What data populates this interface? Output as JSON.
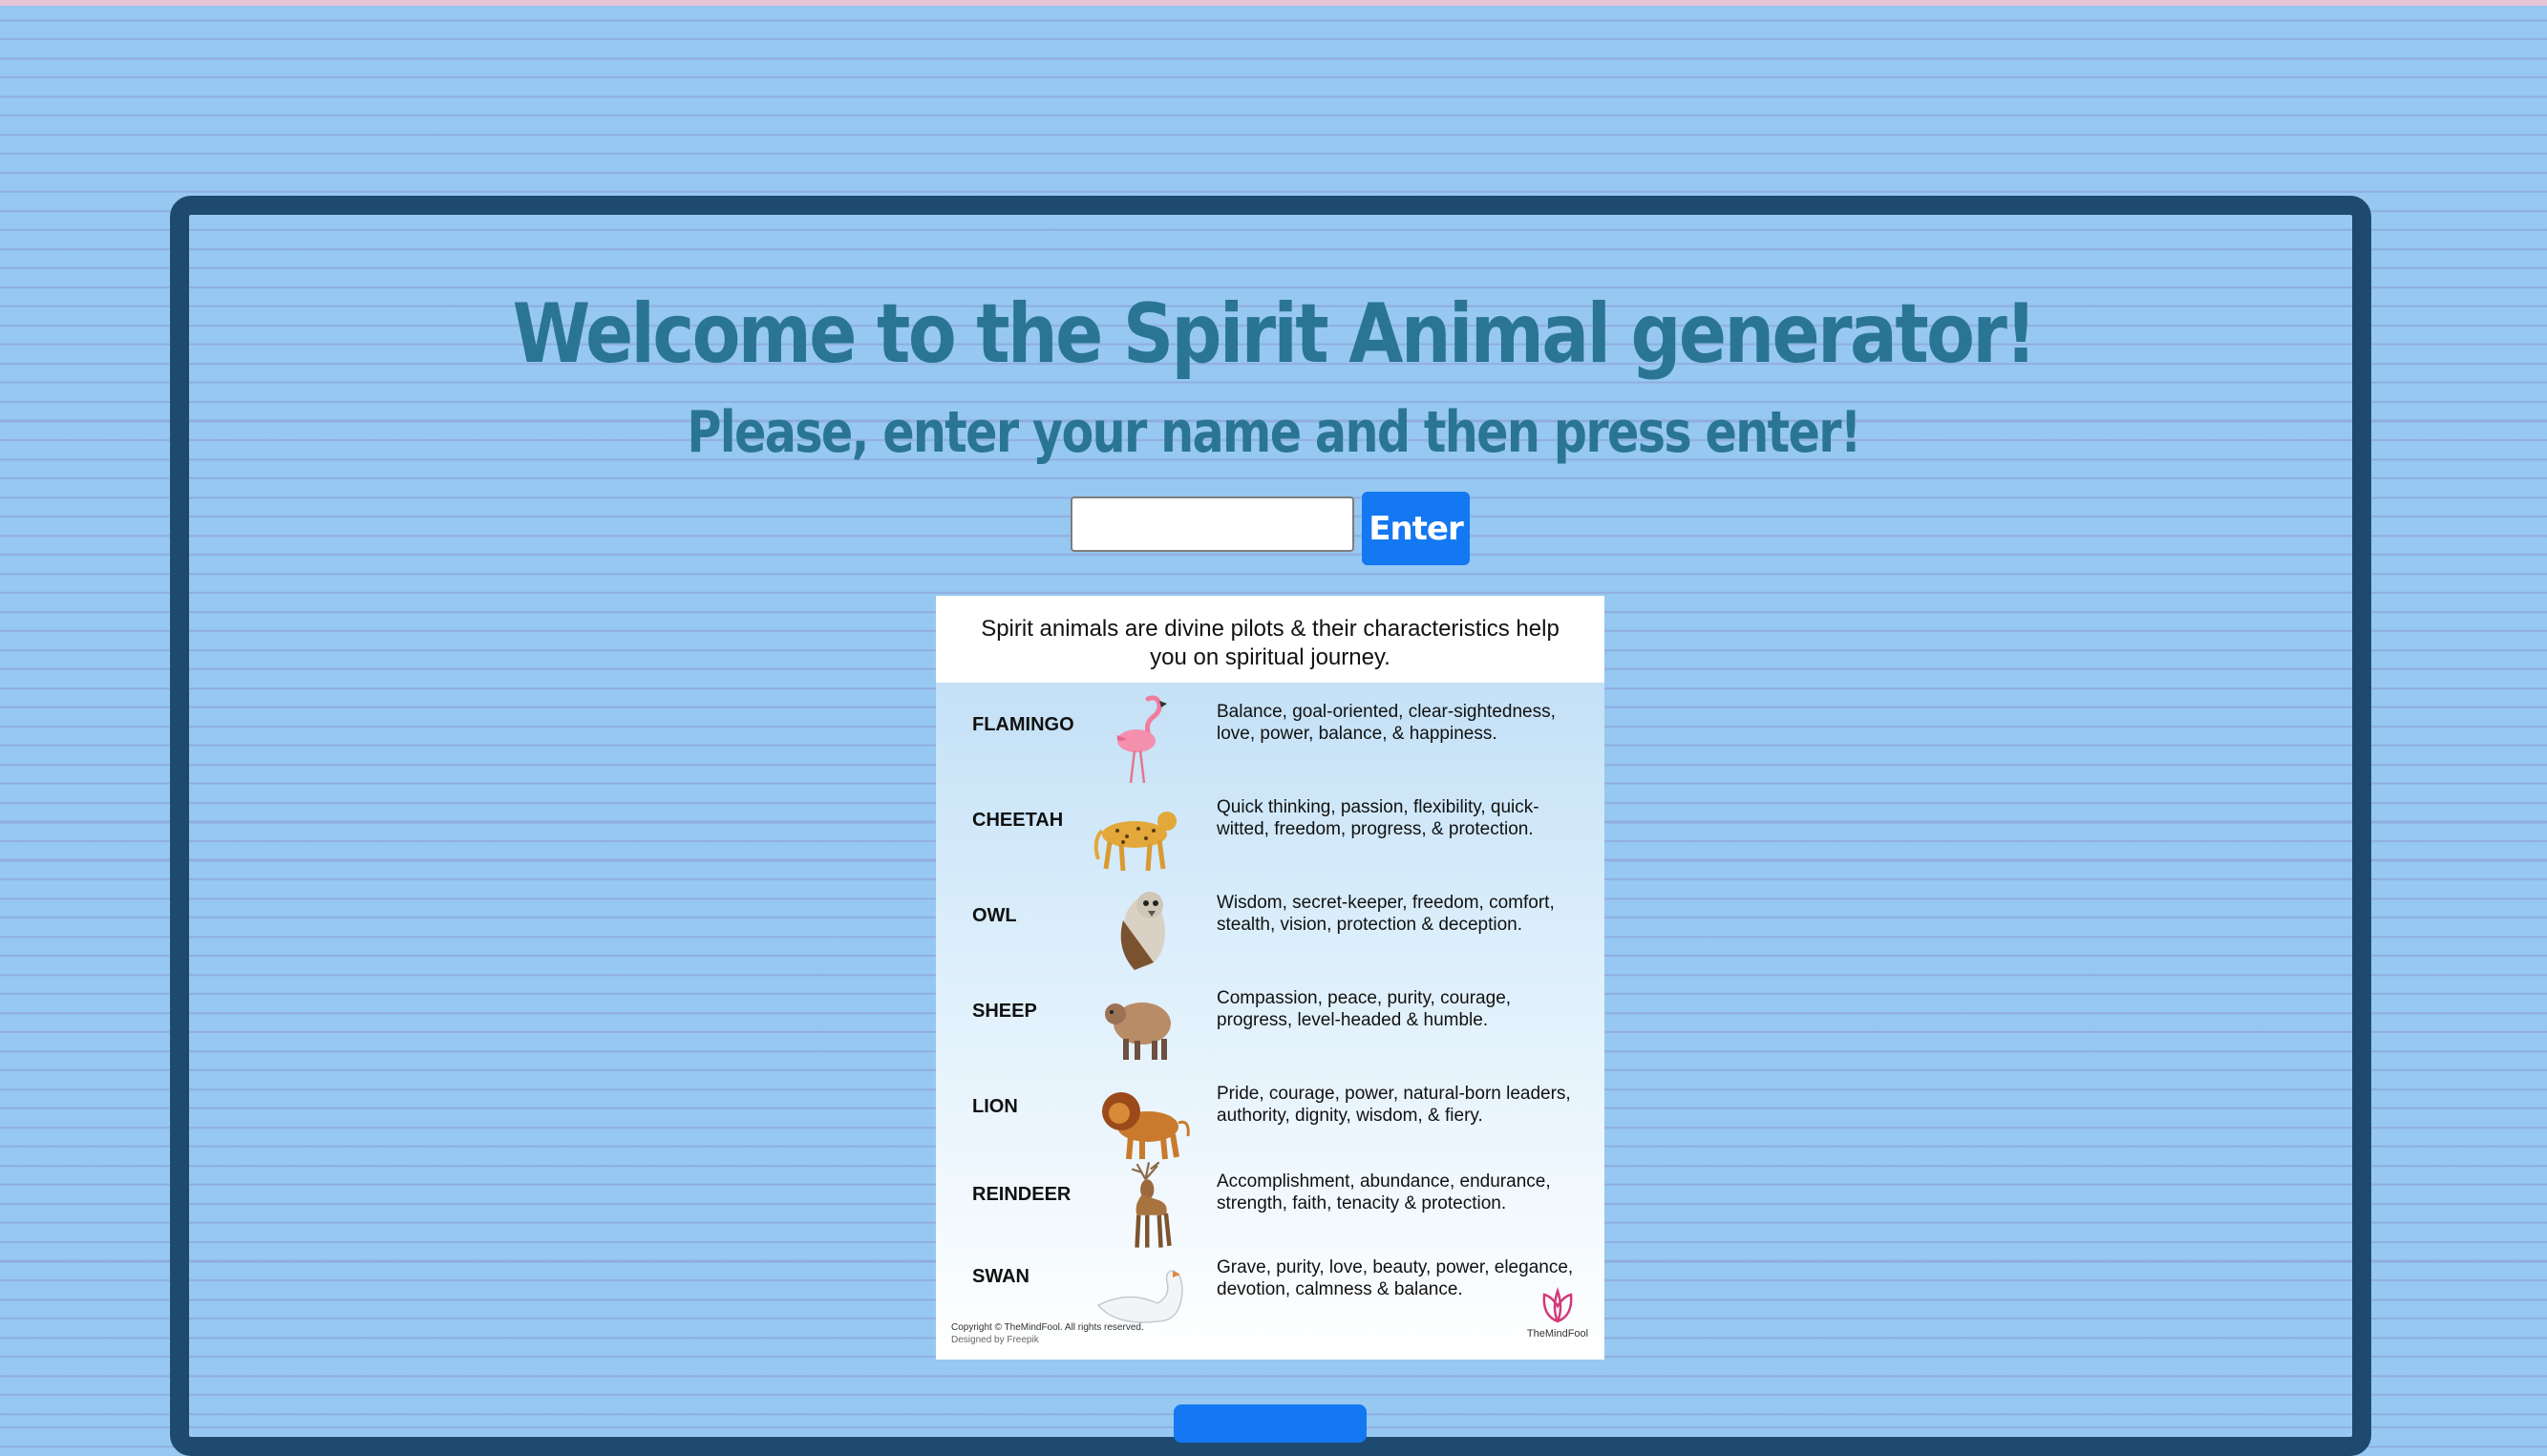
{
  "page": {
    "title": "Welcome to the Spirit Animal generator!",
    "subtitle": "Please, enter your name and then press enter!"
  },
  "form": {
    "name_value": "",
    "enter_label": "Enter"
  },
  "chart": {
    "intro_line1": "Spirit animals are divine pilots & their characteristics help",
    "intro_line2": "you on spiritual journey.",
    "animals": [
      {
        "name": "FLAMINGO",
        "icon": "flamingo-icon",
        "description": "Balance, goal-oriented, clear-sightedness, love, power, balance, & happiness."
      },
      {
        "name": "CHEETAH",
        "icon": "cheetah-icon",
        "description": "Quick thinking, passion, flexibility, quick-witted, freedom, progress, & protection."
      },
      {
        "name": "OWL",
        "icon": "owl-icon",
        "description": "Wisdom, secret-keeper, freedom, comfort, stealth, vision, protection & deception."
      },
      {
        "name": "SHEEP",
        "icon": "sheep-icon",
        "description": "Compassion, peace, purity, courage, progress, level-headed & humble."
      },
      {
        "name": "LION",
        "icon": "lion-icon",
        "description": "Pride, courage, power, natural-born leaders, authority, dignity, wisdom, & fiery."
      },
      {
        "name": "REINDEER",
        "icon": "reindeer-icon",
        "description": "Accomplishment, abundance, endurance, strength, faith, tenacity & protection."
      },
      {
        "name": "SWAN",
        "icon": "swan-icon",
        "description": "Grave, purity, love, beauty, power, elegance, devotion, calmness & balance."
      }
    ],
    "copyright": "Copyright © TheMindFool. All rights reserved.",
    "credit": "Designed by Freepik",
    "brand": "TheMindFool"
  },
  "colors": {
    "background": "#96c8f2",
    "frame": "#1f4a70",
    "heading": "#2a7593",
    "button": "#1478f2"
  }
}
